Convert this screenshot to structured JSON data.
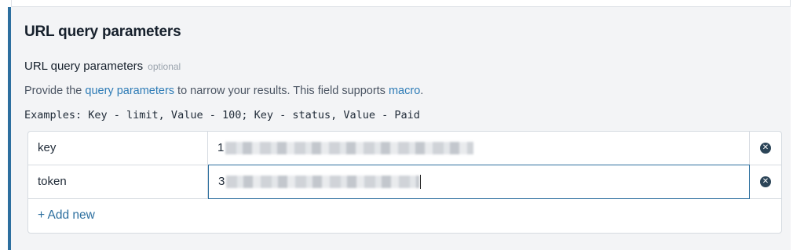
{
  "section": {
    "title": "URL query parameters",
    "field_label": "URL query parameters",
    "optional_tag": "optional",
    "help": {
      "prefix": "Provide the ",
      "link1": "query parameters",
      "middle": " to narrow your results. This field supports ",
      "link2": "macro",
      "suffix": "."
    },
    "examples": "Examples: Key - limit, Value - 100; Key - status, Value - Paid"
  },
  "params": [
    {
      "key": "key",
      "value_visible_prefix": "1"
    },
    {
      "key": "token",
      "value_visible_prefix": "3"
    }
  ],
  "add_new_label": "+ Add new",
  "icons": {
    "remove": "remove-circle-icon"
  },
  "colors": {
    "accent": "#2d6f9f",
    "link": "#2d7bb6",
    "panel_bg": "#f3f4f6"
  }
}
